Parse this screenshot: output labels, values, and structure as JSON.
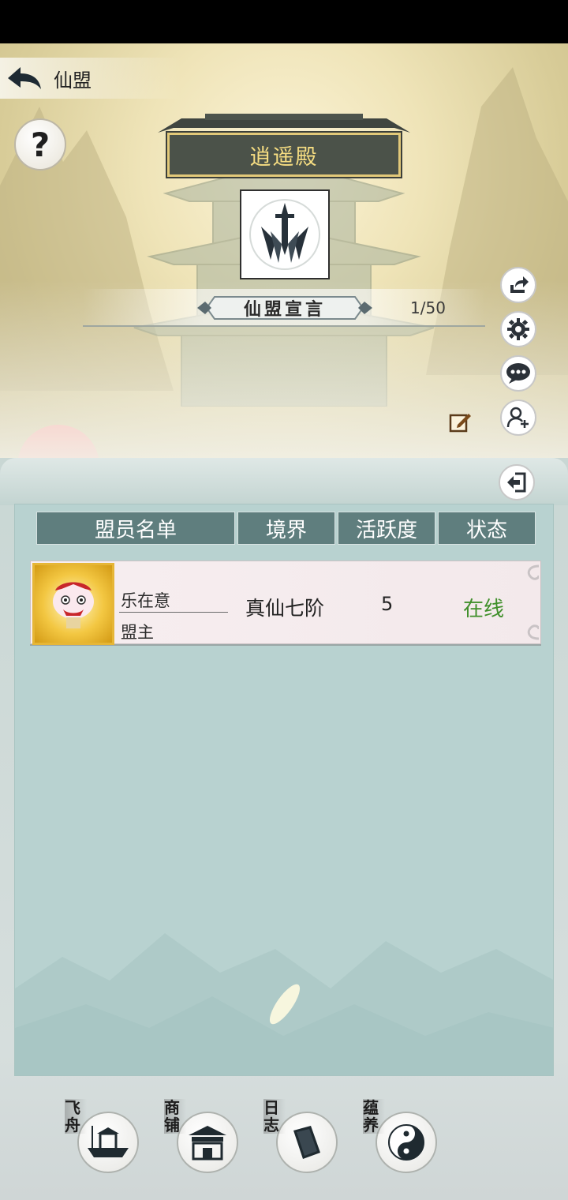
{
  "header": {
    "title": "仙盟",
    "back_icon": "back-arrow-icon"
  },
  "help": {
    "label": "?"
  },
  "guild": {
    "name": "逍遥殿",
    "emblem_icon": "sword-emblem-icon",
    "declaration_label": "仙盟宣言",
    "member_count": "1/50"
  },
  "side_actions": [
    {
      "icon": "share-icon"
    },
    {
      "icon": "gear-icon"
    },
    {
      "icon": "chat-icon"
    },
    {
      "icon": "add-user-icon"
    }
  ],
  "table": {
    "headers": [
      "盟员名单",
      "境界",
      "活跃度",
      "状态"
    ],
    "rows": [
      {
        "name": "乐在意",
        "role": "盟主",
        "realm": "真仙七阶",
        "activity": "5",
        "status": "在线"
      }
    ]
  },
  "dock": [
    {
      "label": "飞舟",
      "icon": "boat-icon"
    },
    {
      "label": "商铺",
      "icon": "shop-icon"
    },
    {
      "label": "日志",
      "icon": "book-icon"
    },
    {
      "label": "蕴养",
      "icon": "yin-yang-icon"
    }
  ],
  "colors": {
    "plaque_bg": "#4b5249",
    "plaque_text": "#f7de82",
    "header_cell": "#5f7e7e",
    "status_online": "#3f8f2a",
    "panel_bg": "#b8d2d0"
  }
}
